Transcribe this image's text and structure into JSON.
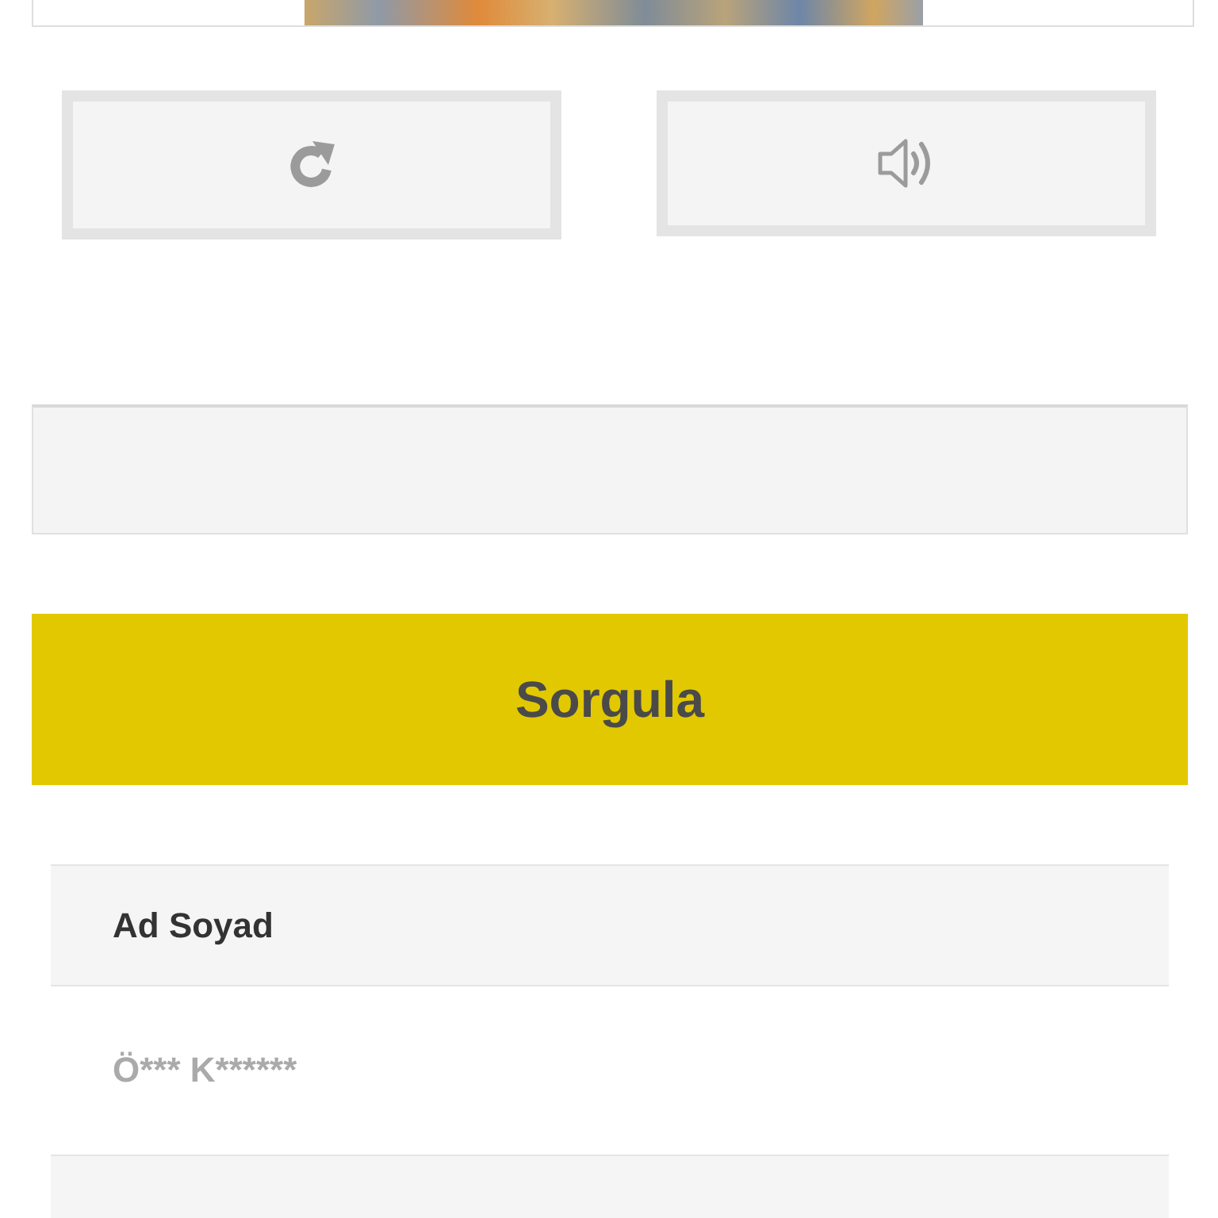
{
  "captcha_buttons": [
    {
      "kind": "refresh"
    },
    {
      "kind": "audio"
    }
  ],
  "submit_button": {
    "label": "Sorgula"
  },
  "result_rows": [
    {
      "kind": "label",
      "text": "Ad Soyad"
    },
    {
      "kind": "value",
      "text": "Ö*** K******"
    },
    {
      "kind": "label"
    }
  ]
}
